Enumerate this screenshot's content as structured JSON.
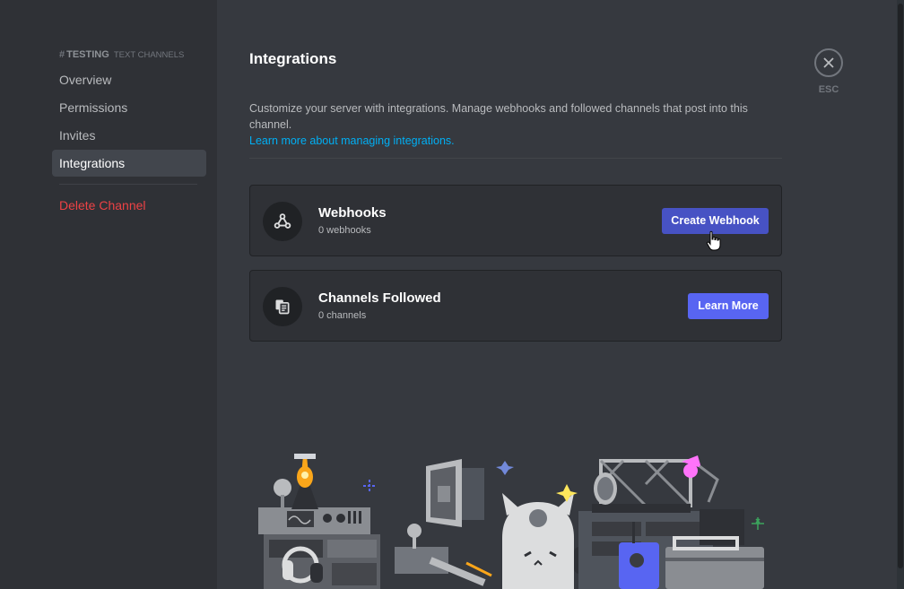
{
  "sidebar": {
    "channel_name": "TESTING",
    "channel_category": "TEXT CHANNELS",
    "items": [
      {
        "label": "Overview"
      },
      {
        "label": "Permissions"
      },
      {
        "label": "Invites"
      },
      {
        "label": "Integrations"
      }
    ],
    "delete_label": "Delete Channel"
  },
  "main": {
    "title": "Integrations",
    "description": "Customize your server with integrations. Manage webhooks and followed channels that post into this channel.",
    "learn_link": "Learn more about managing integrations.",
    "cards": [
      {
        "title": "Webhooks",
        "subtitle": "0 webhooks",
        "button": "Create Webhook",
        "icon": "webhook-icon"
      },
      {
        "title": "Channels Followed",
        "subtitle": "0 channels",
        "button": "Learn More",
        "icon": "channels-followed-icon"
      }
    ]
  },
  "close": {
    "esc_label": "ESC"
  },
  "colors": {
    "accent": "#5865f2",
    "accent_hover": "#4752c4",
    "danger": "#ed4245",
    "link": "#00aff4"
  }
}
